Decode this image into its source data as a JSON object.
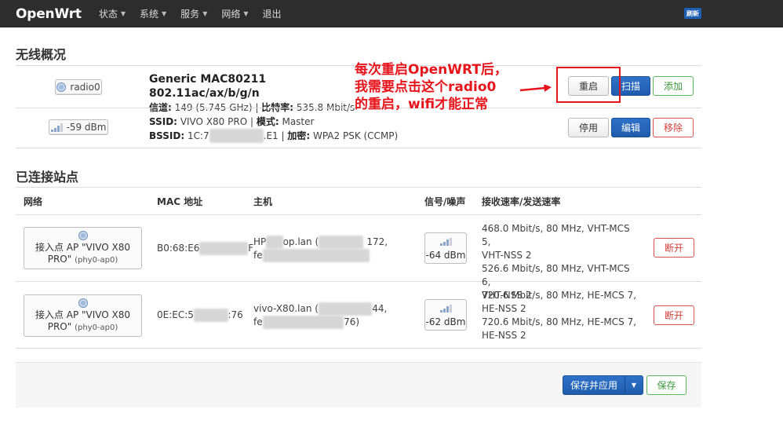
{
  "navbar": {
    "brand": "OpenWrt",
    "items": [
      "状态",
      "系统",
      "服务",
      "网络",
      "退出"
    ],
    "refresh_badge": "刷新"
  },
  "wireless": {
    "heading": "无线概况",
    "radio": {
      "badge": "radio0",
      "title": "Generic MAC80211 802.11ac/ax/b/g/n",
      "channel_label": "信道:",
      "channel_value": "149 (5.745 GHz)",
      "bitrate_label": "比特率:",
      "bitrate_value": "535.8 Mbit/s",
      "buttons": {
        "restart": "重启",
        "scan": "扫描",
        "add": "添加"
      }
    },
    "network": {
      "badge": "-59 dBm",
      "ssid_label": "SSID:",
      "ssid_value": "VIVO X80 PRO",
      "mode_label": "模式:",
      "mode_value": "Master",
      "bssid_label": "BSSID:",
      "bssid_prefix": "1C:7",
      "bssid_suffix": "E1",
      "encryption_label": "加密:",
      "encryption_value": "WPA2 PSK (CCMP)",
      "buttons": {
        "disable": "停用",
        "edit": "编辑",
        "remove": "移除"
      }
    }
  },
  "annotation": {
    "line1": "每次重启OpenWRT后，",
    "line2": "我需要点击这个radio0",
    "line3": "的重启，wifi才能正常",
    "color": "#e8141c"
  },
  "stations": {
    "heading": "已连接站点",
    "columns": [
      "网络",
      "MAC 地址",
      "主机",
      "信号/噪声",
      "接收速率/发送速率"
    ],
    "rows": [
      {
        "network_line1": "接入点 AP \"VIVO X80",
        "network_line2": "PRO\"",
        "network_sub": "(phy0-ap0)",
        "mac_prefix": "B0:68:E6",
        "mac_suffix": "F",
        "host_line1_prefix": "HP",
        "host_line1_mid": "op.lan (",
        "host_line1_suffix": "172,",
        "host_line2_prefix": "fe",
        "signal": "-64 dBm",
        "rx": "468.0 Mbit/s, 80 MHz, VHT-MCS 5,",
        "rx2": "VHT-NSS 2",
        "tx": "526.6 Mbit/s, 80 MHz, VHT-MCS 6,",
        "tx2": "VHT-NSS 2",
        "disconnect": "断开"
      },
      {
        "network_line1": "接入点 AP \"VIVO X80",
        "network_line2": "PRO\"",
        "network_sub": "(phy0-ap0)",
        "mac_prefix": "0E:EC:5",
        "mac_suffix": ":76",
        "host_line1_prefix": "vivo-X80.lan (",
        "host_line1_suffix": "44,",
        "host_line2_prefix": "fe",
        "host_line2_suffix": "76)",
        "signal": "-62 dBm",
        "rx": "720.6 Mbit/s, 80 MHz, HE-MCS 7,",
        "rx2": "HE-NSS 2",
        "tx": "720.6 Mbit/s, 80 MHz, HE-MCS 7,",
        "tx2": "HE-NSS 2",
        "disconnect": "断开"
      }
    ]
  },
  "footer": {
    "save_apply": "保存并应用",
    "save": "保存"
  }
}
